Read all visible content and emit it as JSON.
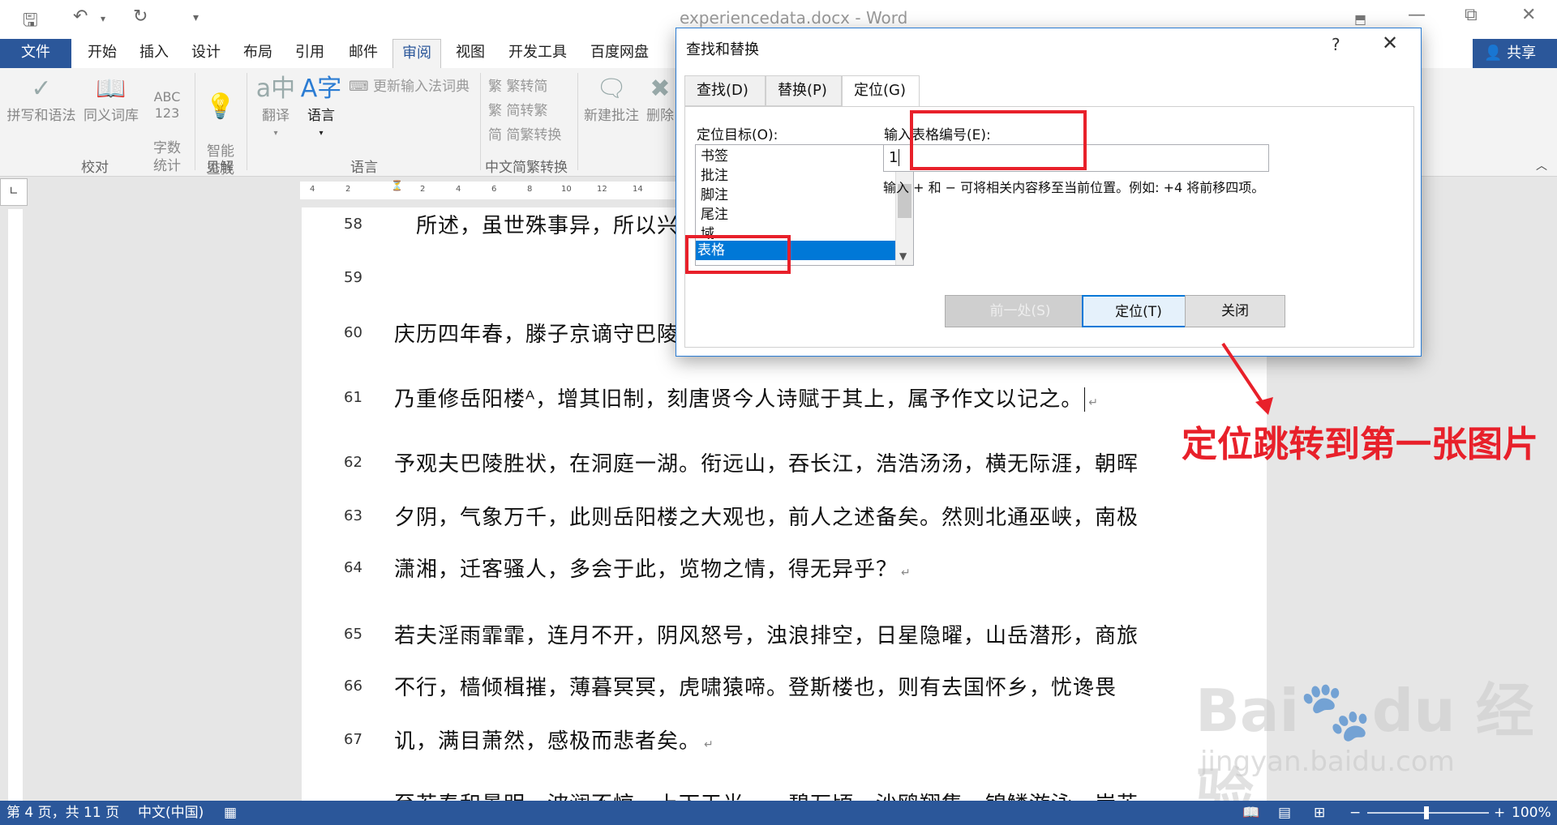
{
  "window": {
    "title": "experiencedata.docx - Word"
  },
  "tabs": [
    "文件",
    "开始",
    "插入",
    "设计",
    "布局",
    "引用",
    "邮件",
    "审阅",
    "视图",
    "开发工具",
    "百度网盘"
  ],
  "share_label": "共享",
  "ribbon": {
    "proofing": {
      "spelling": "拼写和语法",
      "thesaurus": "同义词库",
      "wordcount_icon_text": "ABC\n123",
      "wordcount": "字数\n统计",
      "group": "校对"
    },
    "insights": {
      "smart_lookup": "智能\n查找",
      "group": "见解"
    },
    "language": {
      "translate": "翻译",
      "language": "语言",
      "update_ime": "更新输入法词典",
      "group": "语言"
    },
    "chinese_conversion": {
      "trad_to_simp": "繁转简",
      "simp_to_trad": "简转繁",
      "conversion": "简繁转换",
      "group": "中文简繁转换"
    },
    "comments": {
      "new": "新建批注",
      "delete": "删除"
    }
  },
  "document": {
    "lines": [
      {
        "num": "58",
        "text": "　所述，虽世殊事异，所以兴",
        "pilcrow": false
      },
      {
        "num": "59",
        "text": "",
        "pilcrow": false
      },
      {
        "num": "60",
        "text": "庆历四年春，滕子京谪守巴陵",
        "pilcrow": false
      },
      {
        "num": "61",
        "text": "乃重修岳阳楼ᴬ，增其旧制，刻唐贤今人诗赋于其上，属予作文以记之。",
        "pilcrow": true
      },
      {
        "num": "62",
        "text": "予观夫巴陵胜状，在洞庭一湖。衔远山，吞长江，浩浩汤汤，横无际涯，朝晖",
        "pilcrow": false
      },
      {
        "num": "63",
        "text": "夕阴，气象万千，此则岳阳楼之大观也，前人之述备矣。然则北通巫峡，南极",
        "pilcrow": false
      },
      {
        "num": "64",
        "text": "潇湘，迁客骚人，多会于此，览物之情，得无异乎？",
        "pilcrow": true
      },
      {
        "num": "65",
        "text": "若夫淫雨霏霏，连月不开，阴风怒号，浊浪排空，日星隐曜，山岳潜形，商旅",
        "pilcrow": false
      },
      {
        "num": "66",
        "text": "不行，樯倾楫摧，薄暮冥冥，虎啸猿啼。登斯楼也，则有去国怀乡，忧谗畏",
        "pilcrow": false
      },
      {
        "num": "67",
        "text": "讥，满目萧然，感极而悲者矣。",
        "pilcrow": true
      },
      {
        "num": "",
        "text": "至若春和景明，波澜不惊，上下天光，一碧万顷，沙鸥翔集，锦鳞游泳，岸芷",
        "pilcrow": false
      }
    ]
  },
  "dialog": {
    "title": "查找和替换",
    "help": "?",
    "tabs": [
      "查找(D)",
      "替换(P)",
      "定位(G)"
    ],
    "goto_what_label": "定位目标(O):",
    "goto_items": [
      "书签",
      "批注",
      "脚注",
      "尾注",
      "域",
      "表格"
    ],
    "selected_item": "表格",
    "enter_label": "输入表格编号(E):",
    "enter_value": "1",
    "hint": "输入 + 和 − 可将相关内容移至当前位置。例如: +4 将前移四项。",
    "buttons": {
      "previous": "前一处(S)",
      "goto": "定位(T)",
      "close": "关闭"
    }
  },
  "annotation": "定位跳转到第一张图片",
  "status": {
    "page": "第 4 页，共 11 页",
    "language": "中文(中国)",
    "zoom": "100%"
  },
  "ruler_numbers": [
    "4",
    "2",
    "2",
    "4",
    "6",
    "8",
    "10",
    "12",
    "14"
  ]
}
